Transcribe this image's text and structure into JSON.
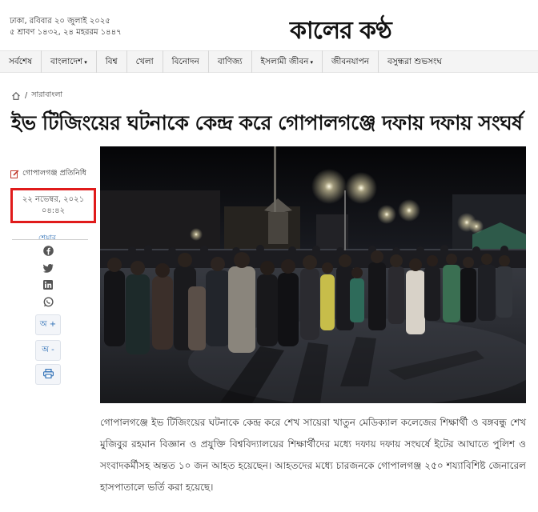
{
  "header": {
    "date_line_1": "ঢাকা, রবিবার ২০ জুলাই ২০২৫",
    "date_line_2": "৫ শ্রাবণ ১৪৩২, ২৪ মহররম ১৪৪৭",
    "logo_text": "কালের কণ্ঠ"
  },
  "nav": {
    "items": [
      {
        "label": "সর্বশেষ",
        "dropdown": false
      },
      {
        "label": "বাংলাদেশ",
        "dropdown": true
      },
      {
        "label": "বিশ্ব",
        "dropdown": false
      },
      {
        "label": "খেলা",
        "dropdown": false
      },
      {
        "label": "বিনোদন",
        "dropdown": false
      },
      {
        "label": "বাণিজ্য",
        "dropdown": false
      },
      {
        "label": "ইসলামী জীবন",
        "dropdown": true
      },
      {
        "label": "জীবনযাপন",
        "dropdown": false
      },
      {
        "label": "বসুন্ধরা শুভসংঘ",
        "dropdown": false
      }
    ],
    "caret_symbol": "▾"
  },
  "breadcrumb": {
    "separator": "/",
    "section": "সারাবাংলা"
  },
  "article": {
    "headline": "ইভ টিজিংয়ের ঘটনাকে কেন্দ্র করে গোপালগঞ্জে দফায় দফায় সংঘর্ষ",
    "reporter": "গোপালগঞ্জ প্রতিনিধি",
    "date": "২২ নভেম্বর, ২০২১",
    "time": "০৪:৪২",
    "body": "গোপালগঞ্জে ইভ টিজিংয়ের ঘটনাকে কেন্দ্র করে শেখ সায়েরা খাতুন মেডিক্যাল কলেজের শিক্ষার্থী ও বঙ্গবন্ধু শেখ মুজিবুর রহমান বিজ্ঞান ও প্রযুক্তি বিশ্ববিদ্যালয়ের শিক্ষার্থীদের মধ্যে দফায় দফায় সংঘর্ষে ইটের আঘাতে পুলিশ ও সংবাদকর্মীসহ অন্তত ১০ জন আহত হয়েছেন। আহতদের মধ্যে চারজনকে গোপালগঞ্জ ২৫০ শয্যাবিশিষ্ট জেনারেল হাসপাতালে ভর্তি করা হয়েছে।"
  },
  "share": {
    "label": "শেয়ার",
    "icons": [
      "facebook-icon",
      "twitter-icon",
      "linkedin-icon",
      "whatsapp-icon"
    ],
    "font_increase": "অ +",
    "font_decrease": "অ -",
    "print_icon": "print-icon"
  },
  "colors": {
    "highlight_box": "#e01b1b",
    "share_accent": "#2c6eb5",
    "nav_background": "#f4f4f4"
  }
}
